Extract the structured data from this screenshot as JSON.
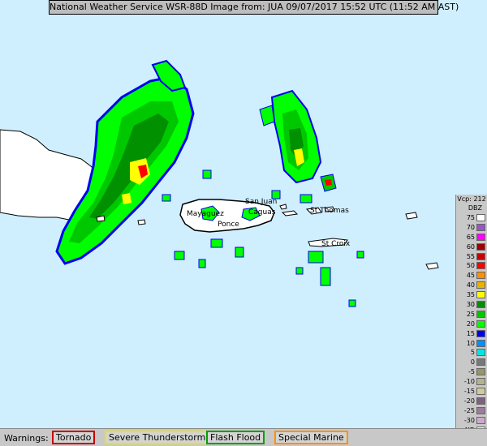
{
  "title": "National Weather Service WSR-88D Image from: JUA 09/07/2017 15:52 UTC (11:52 AM AST)",
  "places": {
    "san_juan": "San Juan",
    "caguas": "Caguas",
    "mayaguez": "Mayaguez",
    "ponce": "Ponce",
    "st_thomas": "St Thomas",
    "st_croix": "St Croix"
  },
  "legend": {
    "vcp": "Vcp: 212",
    "unit": "DBZ",
    "levels": [
      {
        "label": "75",
        "color": "#ffffff"
      },
      {
        "label": "70",
        "color": "#9a55c8"
      },
      {
        "label": "65",
        "color": "#ff00ff"
      },
      {
        "label": "60",
        "color": "#a00000"
      },
      {
        "label": "55",
        "color": "#c80000"
      },
      {
        "label": "50",
        "color": "#ff0000"
      },
      {
        "label": "45",
        "color": "#ff9000"
      },
      {
        "label": "40",
        "color": "#e6b400"
      },
      {
        "label": "35",
        "color": "#ffff00"
      },
      {
        "label": "30",
        "color": "#009000"
      },
      {
        "label": "25",
        "color": "#00c800"
      },
      {
        "label": "20",
        "color": "#00ff00"
      },
      {
        "label": "15",
        "color": "#0000f0"
      },
      {
        "label": "10",
        "color": "#0090ff"
      },
      {
        "label": "5",
        "color": "#00e6e6"
      },
      {
        "label": "0",
        "color": "#787878"
      },
      {
        "label": "-5",
        "color": "#969664"
      },
      {
        "label": "-10",
        "color": "#b4b48c"
      },
      {
        "label": "-15",
        "color": "#cccc9c"
      },
      {
        "label": "-20",
        "color": "#806080"
      },
      {
        "label": "-25",
        "color": "#9c7c9c"
      },
      {
        "label": "-30",
        "color": "#ccaacc"
      },
      {
        "label": "ND",
        "color": "#ffffff"
      }
    ]
  },
  "warnings": {
    "label": "Warnings:",
    "items": [
      {
        "label": "Tornado",
        "border": "#c80000"
      },
      {
        "label": "Severe Thunderstorm",
        "border": "#e6e600"
      },
      {
        "label": "Flash Flood",
        "border": "#00a000"
      },
      {
        "label": "Special Marine",
        "border": "#ff9000"
      }
    ]
  }
}
